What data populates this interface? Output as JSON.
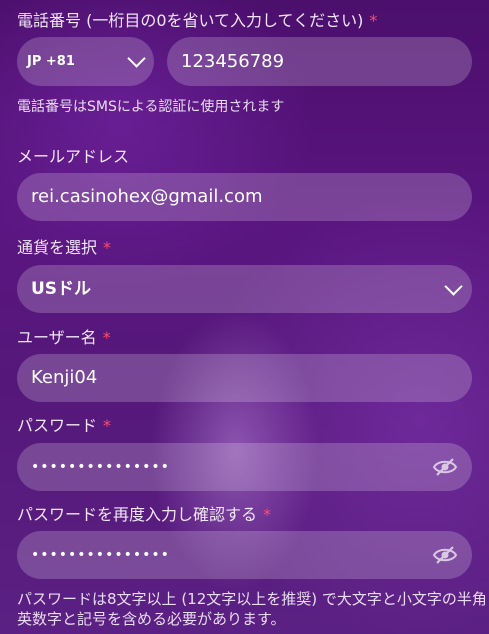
{
  "phone": {
    "label": "電話番号 (一桁目の0を省いて入力してください)",
    "country_code": "JP +81",
    "number": "123456789",
    "hint": "電話番号はSMSによる認証に使用されます"
  },
  "email": {
    "label": "メールアドレス",
    "value": "rei.casinohex@gmail.com"
  },
  "currency": {
    "label": "通貨を選択",
    "selected": "USドル"
  },
  "username": {
    "label": "ユーザー名",
    "value": "Kenji04"
  },
  "password": {
    "label": "パスワード",
    "value": "•••••••••••••••"
  },
  "password_confirm": {
    "label": "パスワードを再度入力し確認する",
    "value": "•••••••••••••••"
  },
  "required_marker": "*",
  "password_rule": "パスワードは8文字以上 (12文字以上を推奨) で大文字と小文字の半角英数字と記号を含める必要があります。",
  "colors": {
    "required": "#ff4d6a",
    "field_bg": "rgba(255,255,255,0.2)",
    "background": "#55187a"
  },
  "icons": {
    "dropdown": "chevron-down-icon",
    "hide_password": "eye-slash-icon"
  }
}
